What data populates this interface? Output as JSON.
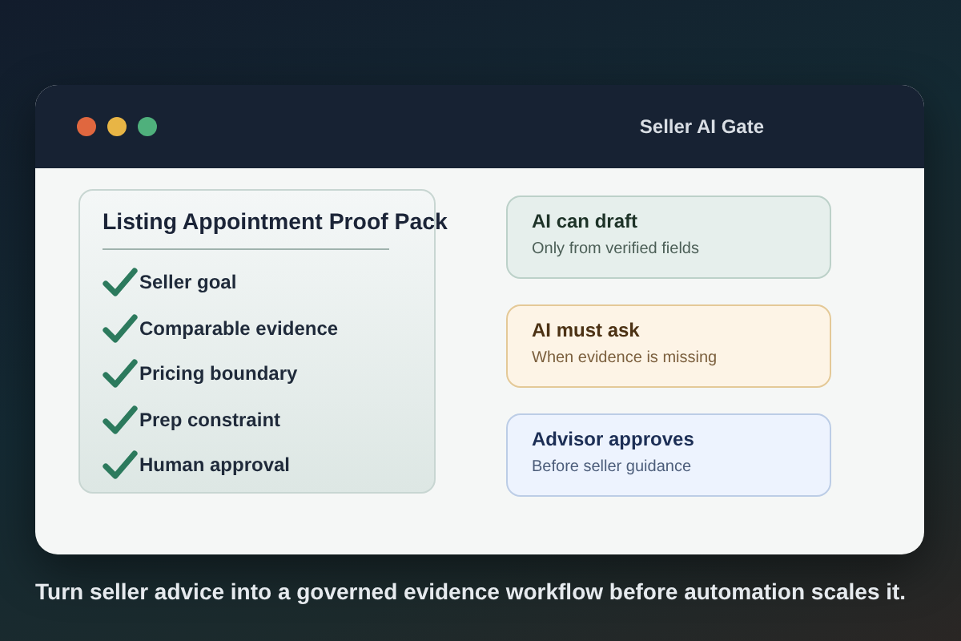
{
  "window": {
    "title": "Seller AI Gate",
    "controls": [
      {
        "color": "#e0673f"
      },
      {
        "color": "#e8b545"
      },
      {
        "color": "#4fb07c"
      }
    ]
  },
  "proof_pack": {
    "title": "Listing Appointment Proof Pack",
    "items": [
      {
        "label": "Seller goal",
        "checked": true
      },
      {
        "label": "Comparable evidence",
        "checked": true
      },
      {
        "label": "Pricing boundary",
        "checked": true
      },
      {
        "label": "Prep constraint",
        "checked": true
      },
      {
        "label": "Human approval",
        "checked": true
      }
    ]
  },
  "rules": [
    {
      "kind": "draft",
      "title": "AI can draft",
      "detail": "Only from verified fields"
    },
    {
      "kind": "ask",
      "title": "AI must ask",
      "detail": "When evidence is missing"
    },
    {
      "kind": "approve",
      "title": "Advisor approves",
      "detail": "Before seller guidance"
    }
  ],
  "caption": "Turn seller advice into a governed evidence workflow before automation scales it."
}
